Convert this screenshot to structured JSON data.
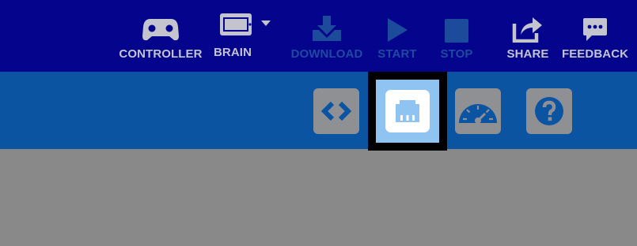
{
  "toolbar": {
    "controller_label": "CONTROLLER",
    "brain_label": "BRAIN",
    "download_label": "DOWNLOAD",
    "start_label": "START",
    "stop_label": "STOP",
    "share_label": "SHARE",
    "feedback_label": "FEEDBACK",
    "colors": {
      "bar": "#04048c",
      "label_enabled": "#c4c4cf",
      "label_disabled": "#1f4aa0",
      "icon_disabled": "#1d4b9c"
    }
  },
  "tabs": {
    "items": [
      {
        "icon": "code-icon",
        "selected": false
      },
      {
        "icon": "port-icon",
        "selected": true
      },
      {
        "icon": "dashboard-gauge-icon",
        "selected": false
      },
      {
        "icon": "help-icon",
        "selected": false
      }
    ],
    "colors": {
      "bar": "#0a54a2",
      "tab_bg": "#8f9094",
      "selected_bg": "#8fc4f2",
      "selection_frame": "#000000"
    }
  },
  "workspace": {
    "background": "#898989"
  }
}
